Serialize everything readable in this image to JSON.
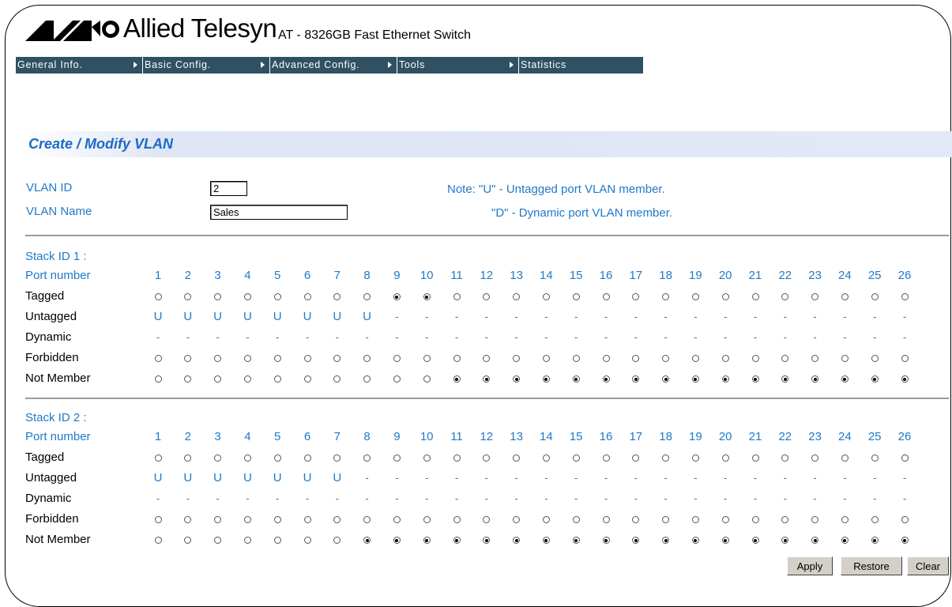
{
  "header": {
    "brand": "Allied Telesyn",
    "model": "AT - 8326GB Fast Ethernet Switch"
  },
  "nav": [
    {
      "label": "General Info.",
      "arrow": true
    },
    {
      "label": "Basic Config.",
      "arrow": true
    },
    {
      "label": "Advanced Config.",
      "arrow": true
    },
    {
      "label": "Tools",
      "arrow": true
    },
    {
      "label": "Statistics",
      "arrow": false
    }
  ],
  "section_title": "Create / Modify VLAN",
  "form": {
    "vlan_id_label": "VLAN ID",
    "vlan_id_value": "2",
    "vlan_name_label": "VLAN Name",
    "vlan_name_value": "Sales"
  },
  "notes": {
    "line1": "Note: \"U\" - Untagged port VLAN member.",
    "line2": "\"D\" - Dynamic port VLAN member."
  },
  "row_labels": {
    "port": "Port number",
    "tagged": "Tagged",
    "untagged": "Untagged",
    "dynamic": "Dynamic",
    "forbidden": "Forbidden",
    "not_member": "Not Member"
  },
  "stacks": [
    {
      "title": "Stack ID 1 :",
      "ports": [
        "1",
        "2",
        "3",
        "4",
        "5",
        "6",
        "7",
        "8",
        "9",
        "10",
        "11",
        "12",
        "13",
        "14",
        "15",
        "16",
        "17",
        "18",
        "19",
        "20",
        "21",
        "22",
        "23",
        "24",
        "25",
        "26"
      ],
      "untagged": [
        "U",
        "U",
        "U",
        "U",
        "U",
        "U",
        "U",
        "U",
        "-",
        "-",
        "-",
        "-",
        "-",
        "-",
        "-",
        "-",
        "-",
        "-",
        "-",
        "-",
        "-",
        "-",
        "-",
        "-",
        "-",
        "-"
      ],
      "dynamic": [
        "-",
        "-",
        "-",
        "-",
        "-",
        "-",
        "-",
        "-",
        "-",
        "-",
        "-",
        "-",
        "-",
        "-",
        "-",
        "-",
        "-",
        "-",
        "-",
        "-",
        "-",
        "-",
        "-",
        "-",
        "-",
        "-"
      ],
      "selected": [
        "none",
        "none",
        "none",
        "none",
        "none",
        "none",
        "none",
        "none",
        "tagged",
        "tagged",
        "not_member",
        "not_member",
        "not_member",
        "not_member",
        "not_member",
        "not_member",
        "not_member",
        "not_member",
        "not_member",
        "not_member",
        "not_member",
        "not_member",
        "not_member",
        "not_member",
        "not_member",
        "not_member"
      ]
    },
    {
      "title": "Stack ID 2 :",
      "ports": [
        "1",
        "2",
        "3",
        "4",
        "5",
        "6",
        "7",
        "8",
        "9",
        "10",
        "11",
        "12",
        "13",
        "14",
        "15",
        "16",
        "17",
        "18",
        "19",
        "20",
        "21",
        "22",
        "23",
        "24",
        "25",
        "26"
      ],
      "untagged": [
        "U",
        "U",
        "U",
        "U",
        "U",
        "U",
        "U",
        "-",
        "-",
        "-",
        "-",
        "-",
        "-",
        "-",
        "-",
        "-",
        "-",
        "-",
        "-",
        "-",
        "-",
        "-",
        "-",
        "-",
        "-",
        "-"
      ],
      "dynamic": [
        "-",
        "-",
        "-",
        "-",
        "-",
        "-",
        "-",
        "-",
        "-",
        "-",
        "-",
        "-",
        "-",
        "-",
        "-",
        "-",
        "-",
        "-",
        "-",
        "-",
        "-",
        "-",
        "-",
        "-",
        "-",
        "-"
      ],
      "selected": [
        "none",
        "none",
        "none",
        "none",
        "none",
        "none",
        "none",
        "not_member",
        "not_member",
        "not_member",
        "not_member",
        "not_member",
        "not_member",
        "not_member",
        "not_member",
        "not_member",
        "not_member",
        "not_member",
        "not_member",
        "not_member",
        "not_member",
        "not_member",
        "not_member",
        "not_member",
        "not_member",
        "not_member"
      ]
    }
  ],
  "buttons": {
    "apply": "Apply",
    "restore": "Restore",
    "clear": "Clear"
  },
  "colors": {
    "nav_bg": "#2f5163",
    "accent_blue": "#1f7ac8",
    "title_blue": "#1c6bc5"
  }
}
